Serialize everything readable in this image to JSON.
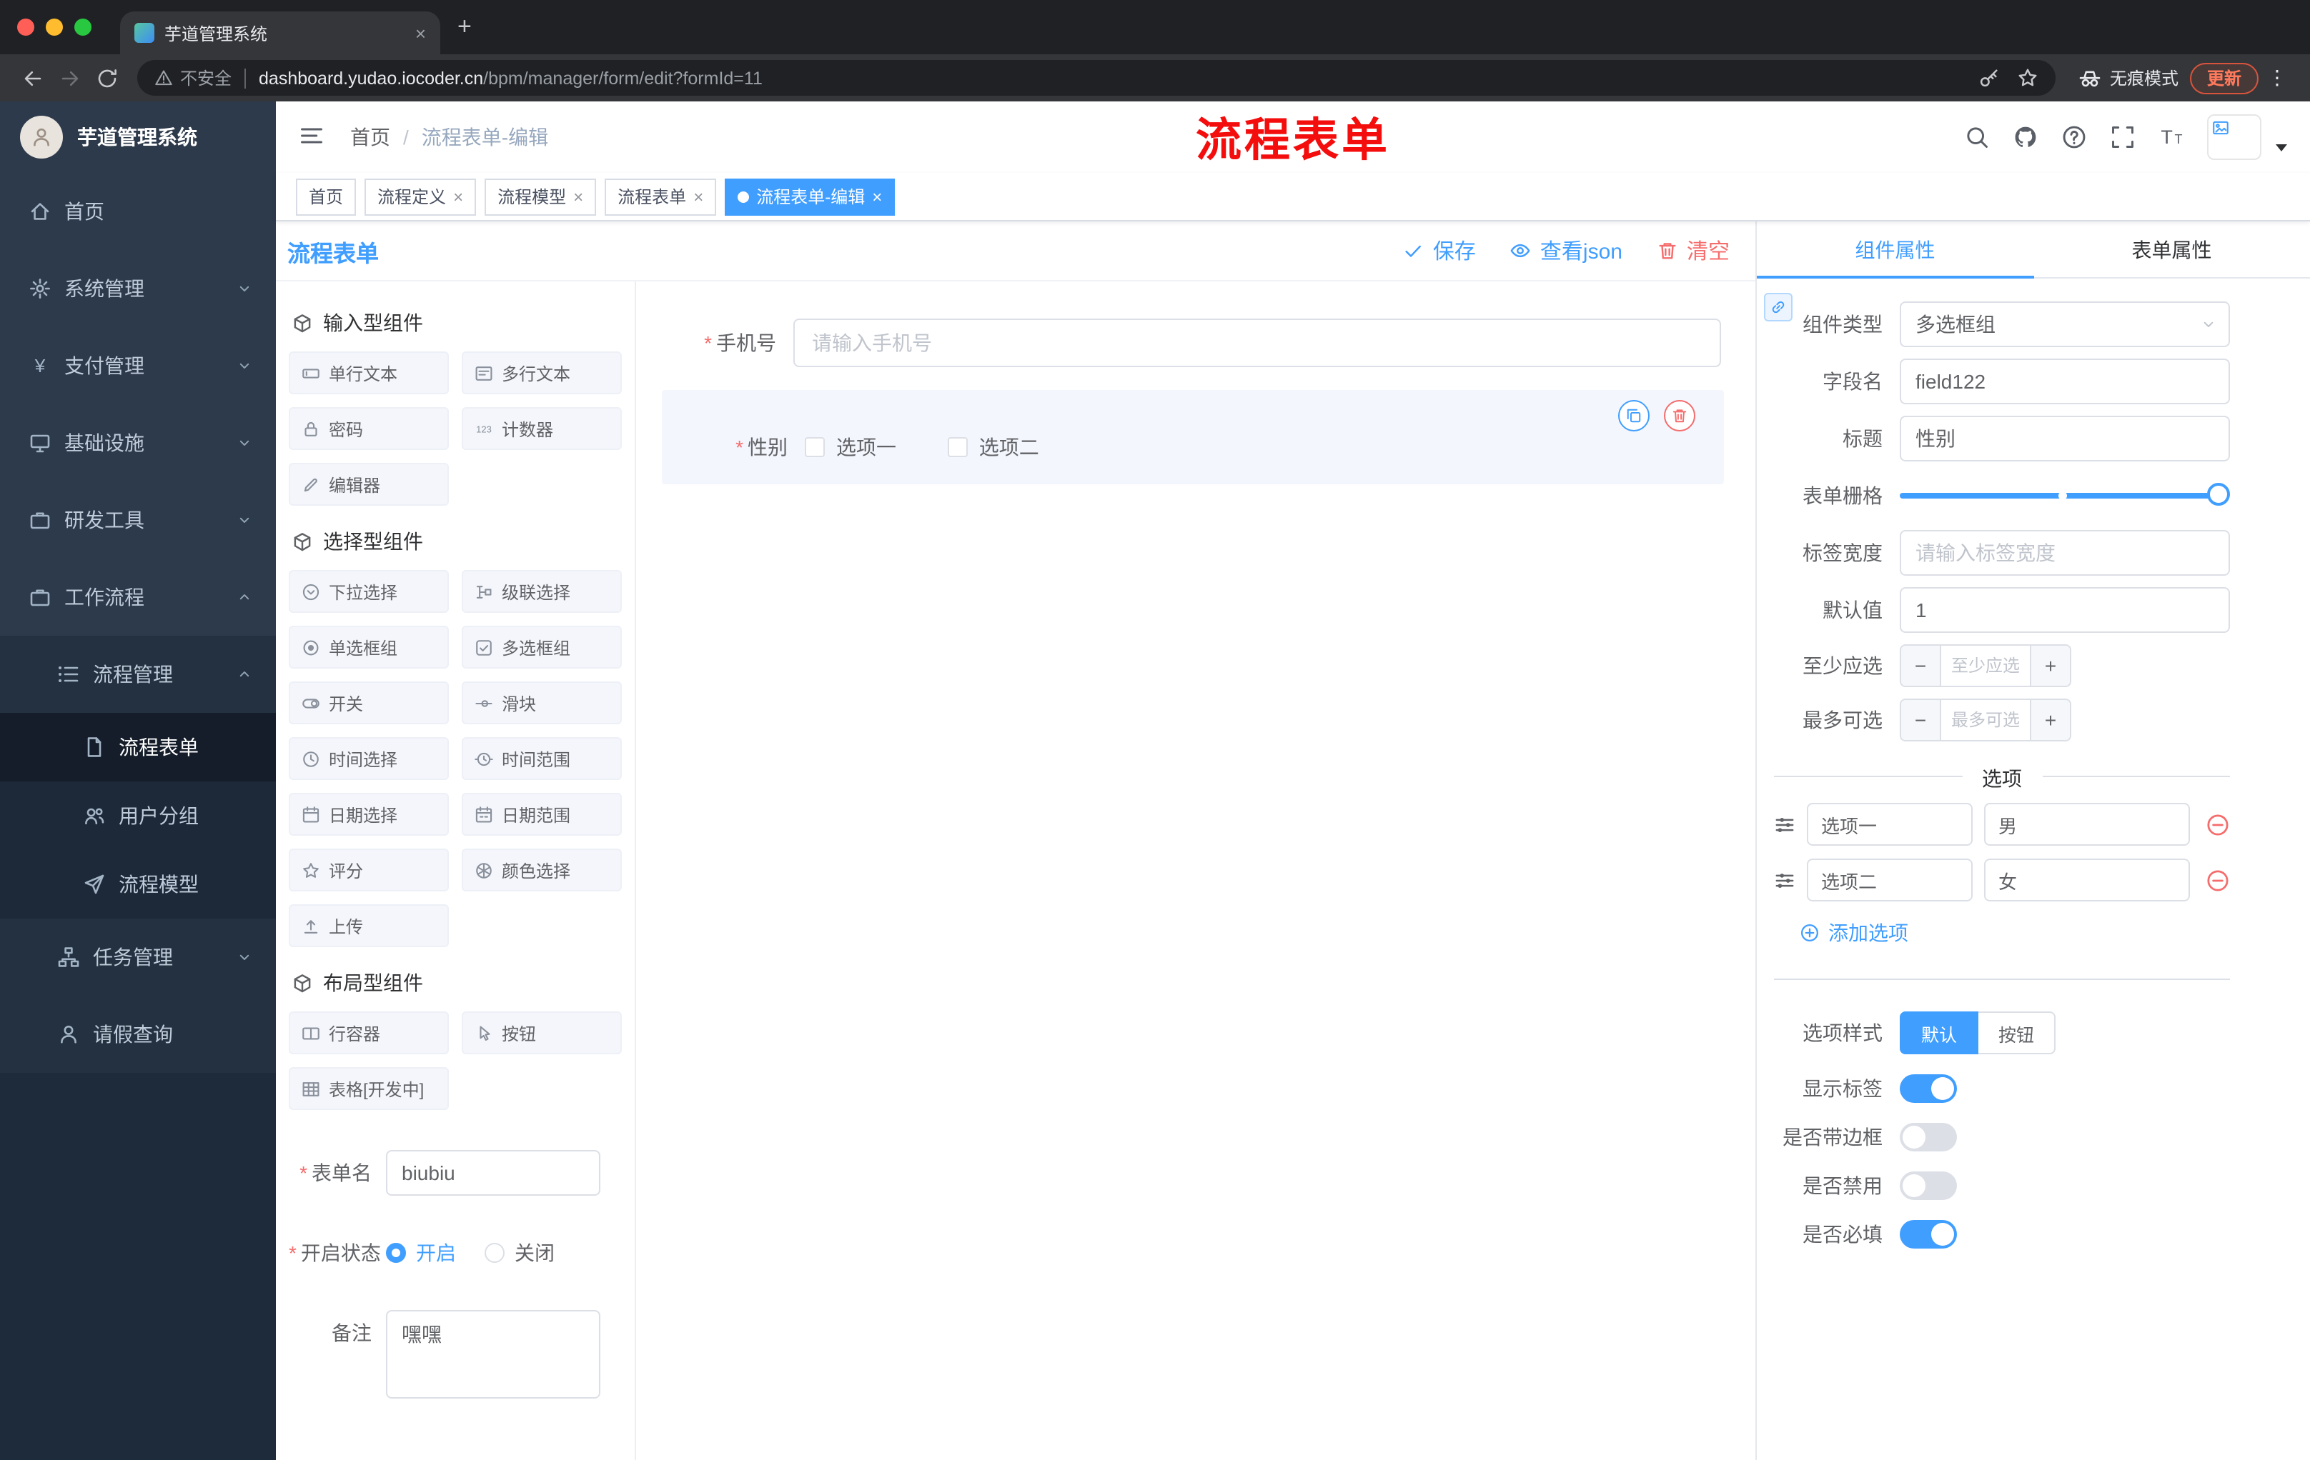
{
  "colors": {
    "accent": "#409eff",
    "danger": "#f56c6c",
    "sidebar_bg": "#1d2b3b",
    "active_tag": "#409eff"
  },
  "browser": {
    "tab_title": "芋道管理系统",
    "security_label": "不安全",
    "url_host": "dashboard.yudao.iocoder.cn",
    "url_path": "/bpm/manager/form/edit?formId=11",
    "incognito_label": "无痕模式",
    "update_label": "更新"
  },
  "sidebar": {
    "logo_title": "芋道管理系统",
    "menu": [
      {
        "label": "首页"
      },
      {
        "label": "系统管理"
      },
      {
        "label": "支付管理"
      },
      {
        "label": "基础设施"
      },
      {
        "label": "研发工具"
      },
      {
        "label": "工作流程"
      },
      {
        "label": "流程管理"
      },
      {
        "label": "流程表单"
      },
      {
        "label": "用户分组"
      },
      {
        "label": "流程模型"
      },
      {
        "label": "任务管理"
      },
      {
        "label": "请假查询"
      }
    ]
  },
  "header": {
    "breadcrumb_home": "首页",
    "breadcrumb_current": "流程表单-编辑"
  },
  "annotation": {
    "text": "流程表单"
  },
  "tags": [
    {
      "label": "首页"
    },
    {
      "label": "流程定义"
    },
    {
      "label": "流程模型"
    },
    {
      "label": "流程表单"
    },
    {
      "label": "流程表单-编辑"
    }
  ],
  "toolbar": {
    "title": "流程表单",
    "save_label": "保存",
    "view_json_label": "查看json",
    "clear_label": "清空"
  },
  "library": {
    "groups": [
      {
        "title": "输入型组件",
        "items": [
          "单行文本",
          "多行文本",
          "密码",
          "计数器",
          "编辑器"
        ]
      },
      {
        "title": "选择型组件",
        "items": [
          "下拉选择",
          "级联选择",
          "单选框组",
          "多选框组",
          "开关",
          "滑块",
          "时间选择",
          "时间范围",
          "日期选择",
          "日期范围",
          "评分",
          "颜色选择",
          "上传"
        ]
      },
      {
        "title": "布局型组件",
        "items": [
          "行容器",
          "按钮",
          "表格[开发中]"
        ]
      }
    ]
  },
  "meta": {
    "form_name": {
      "label": "表单名",
      "value": "biubiu"
    },
    "status": {
      "label": "开启状态",
      "on_label": "开启",
      "off_label": "关闭"
    },
    "remark": {
      "label": "备注",
      "value": "嘿嘿"
    }
  },
  "canvas": {
    "phone": {
      "label": "手机号",
      "placeholder": "请输入手机号"
    },
    "gender": {
      "label": "性别",
      "options": [
        "选项一",
        "选项二"
      ]
    }
  },
  "props": {
    "tab_component": "组件属性",
    "tab_form": "表单属性",
    "component_type": {
      "label": "组件类型",
      "value": "多选框组"
    },
    "field_name": {
      "label": "字段名",
      "value": "field122"
    },
    "title": {
      "label": "标题",
      "value": "性别"
    },
    "grid": {
      "label": "表单栅格"
    },
    "label_width": {
      "label": "标签宽度",
      "placeholder": "请输入标签宽度"
    },
    "default_value": {
      "label": "默认值",
      "value": "1"
    },
    "min_select": {
      "label": "至少应选",
      "placeholder": "至少应选"
    },
    "max_select": {
      "label": "最多可选",
      "placeholder": "最多可选"
    },
    "options_title": "选项",
    "options": [
      {
        "label": "选项一",
        "value": "男"
      },
      {
        "label": "选项二",
        "value": "女"
      }
    ],
    "add_option_label": "添加选项",
    "option_style": {
      "label": "选项样式",
      "choices": [
        "默认",
        "按钮"
      ],
      "selected": "默认"
    },
    "toggles": [
      {
        "label": "显示标签",
        "on": true
      },
      {
        "label": "是否带边框",
        "on": false
      },
      {
        "label": "是否禁用",
        "on": false
      },
      {
        "label": "是否必填",
        "on": true
      }
    ]
  }
}
